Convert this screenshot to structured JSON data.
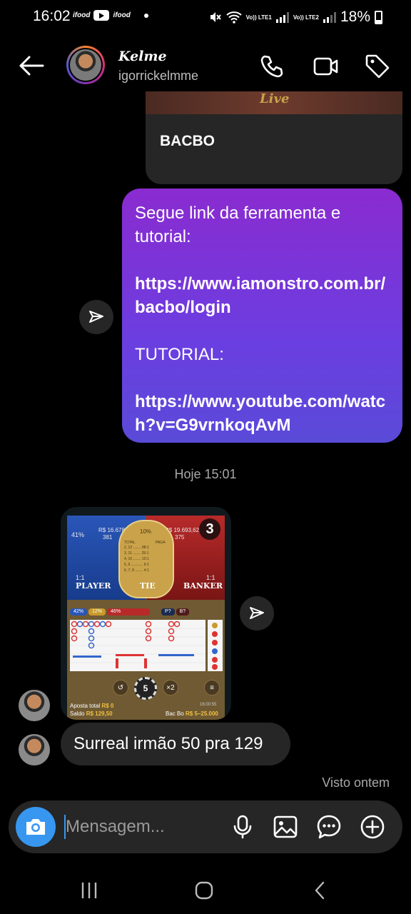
{
  "status_bar": {
    "time": "16:02",
    "app1": "ifood",
    "app2": "ifood",
    "lte1": "Vo)) LTE1",
    "lte2": "Vo)) LTE2",
    "battery": "18%"
  },
  "header": {
    "name": "Kelme",
    "handle": "igorrickelmme",
    "icons": [
      "back-arrow-icon",
      "phone-icon",
      "video-camera-icon",
      "tag-icon"
    ]
  },
  "messages": {
    "card": {
      "label": "BACBO",
      "image_text": "Live"
    },
    "outgoing": {
      "line1": "Segue link da  ferramenta e tutorial:",
      "link1": "https://www.iamonstro.com.br/bacbo/login",
      "line2": "TUTORIAL:",
      "link2": "https://www.youtube.com/watch?v=G9vrnkoqAvM"
    },
    "timestamp": "Hoje 15:01",
    "game": {
      "player_pct": "41%",
      "player_amount": "R$ 16.678,03",
      "player_users": "381",
      "banker_amount": "R$ 19.693,62",
      "banker_users": "375",
      "tie_pct": "10%",
      "round": "3",
      "tie_header_total": "TOTAL",
      "tie_header_pays": "PAGA",
      "tie_rows": [
        "2, 12 ........ 88:1",
        "3, 11 ........ 25:1",
        "4, 10 ........ 10:1",
        "5, 9 ............ 6:1",
        "6, 7, 8 ........ 4:1"
      ],
      "player_ratio": "1:1",
      "banker_ratio": "1:1",
      "player_label": "PLAYER",
      "tie_label": "TIE",
      "banker_label": "BANKER",
      "stat_player": "42%",
      "stat_tie": "12%",
      "stat_banker": "46%",
      "p_hint": "P?",
      "b_hint": "B?",
      "chip": "5",
      "mult": "×2",
      "aposta_label": "Aposta total",
      "aposta_value": "R$ 0",
      "saldo_label": "Saldo",
      "saldo_value": "R$ 129,50",
      "time": "16:00:55",
      "game_name": "Bac Bo",
      "limits": "R$ 5–25.000"
    },
    "incoming": "Surreal irmão 50 pra 129",
    "seen": "Visto ontem"
  },
  "composer": {
    "placeholder": "Mensagem...",
    "icons": [
      "camera-icon",
      "microphone-icon",
      "gallery-icon",
      "sticker-icon",
      "plus-icon"
    ]
  },
  "colors": {
    "bubble_out_top": "#8a2bd0",
    "bubble_out_bottom": "#5a4ad8",
    "camera_button": "#3797f0",
    "bubble_in": "#262626"
  }
}
